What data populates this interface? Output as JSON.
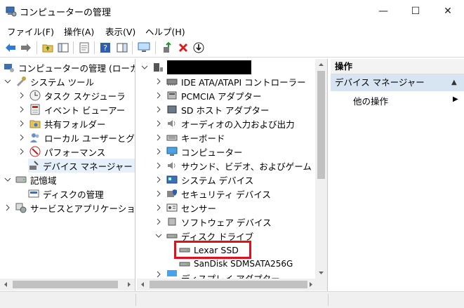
{
  "window": {
    "title": "コンピューターの管理",
    "minimize": "—",
    "maximize": "☐",
    "close": "✕"
  },
  "menu": [
    "ファイル(F)",
    "操作(A)",
    "表示(V)",
    "ヘルプ(H)"
  ],
  "left_tree": {
    "root": "コンピューターの管理 (ローカ",
    "system_tools": "システム ツール",
    "task_scheduler": "タスク スケジューラ",
    "event_viewer": "イベント ビューアー",
    "shared_folders": "共有フォルダー",
    "local_users": "ローカル ユーザーとグ",
    "performance": "パフォーマンス",
    "device_manager": "デバイス マネージャー",
    "storage": "記憶域",
    "disk_management": "ディスクの管理",
    "services_apps": "サービスとアプリケーショ"
  },
  "device_tree": {
    "categories": [
      "IDE ATA/ATAPI コントローラー",
      "PCMCIA アダプター",
      "SD ホスト アダプター",
      "オーディオの入力および出力",
      "キーボード",
      "コンピューター",
      "サウンド、ビデオ、およびゲーム コ",
      "システム デバイス",
      "セキュリティ デバイス",
      "センサー",
      "ソフトウェア デバイス",
      "ディスク ドライブ"
    ],
    "disk_drives": [
      "Lexar SSD",
      "SanDisk SDMSATA256G"
    ],
    "next_category_partial": "ディスプレイ アダプター"
  },
  "actions_pane": {
    "header": "操作",
    "section": "デバイス マネージャー",
    "other_ops": "他の操作",
    "collapse_arrow": "▲",
    "more_arrow": "▶"
  },
  "colors": {
    "highlight_box": "#e0101e",
    "selection": "#e5f0fb",
    "section_bg": "#d7e4f2"
  }
}
